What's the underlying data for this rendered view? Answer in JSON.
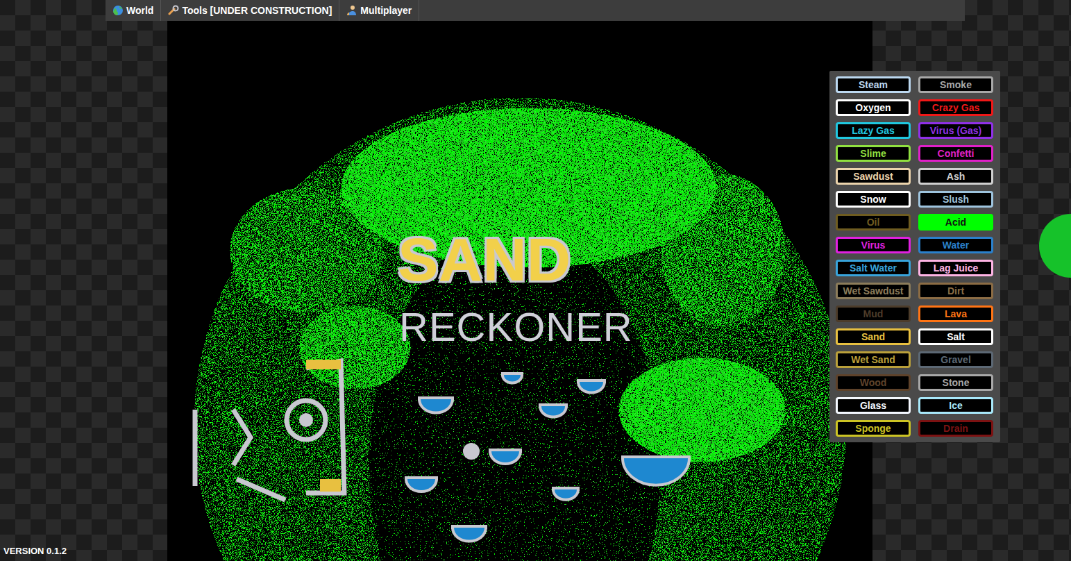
{
  "nav": {
    "items": [
      {
        "label": "World"
      },
      {
        "label": "Tools [UNDER CONSTRUCTION]"
      },
      {
        "label": "Multiplayer"
      }
    ]
  },
  "canvas": {
    "texts": [
      "SAND",
      "RECKONER"
    ]
  },
  "elements": {
    "items": [
      {
        "label": "Steam",
        "color": "#bcd8f0",
        "selected": false
      },
      {
        "label": "Smoke",
        "color": "#a8a8a8",
        "selected": false
      },
      {
        "label": "Oxygen",
        "color": "#ffffff",
        "selected": false
      },
      {
        "label": "Crazy Gas",
        "color": "#f01818",
        "selected": false
      },
      {
        "label": "Lazy Gas",
        "color": "#20c8e0",
        "selected": false
      },
      {
        "label": "Virus (Gas)",
        "color": "#9030e8",
        "selected": false
      },
      {
        "label": "Slime",
        "color": "#90e040",
        "selected": false
      },
      {
        "label": "Confetti",
        "color": "#e020c8",
        "selected": false
      },
      {
        "label": "Sawdust",
        "color": "#ecd4ac",
        "selected": false
      },
      {
        "label": "Ash",
        "color": "#d0d0d0",
        "selected": false
      },
      {
        "label": "Snow",
        "color": "#ffffff",
        "selected": false
      },
      {
        "label": "Slush",
        "color": "#9ec4de",
        "selected": false
      },
      {
        "label": "Oil",
        "color": "#6e5c20",
        "selected": false
      },
      {
        "label": "Acid",
        "color": "#00ff00",
        "selected": true
      },
      {
        "label": "Virus",
        "color": "#e020e0",
        "selected": false
      },
      {
        "label": "Water",
        "color": "#2a80cc",
        "selected": false
      },
      {
        "label": "Salt Water",
        "color": "#38a4dc",
        "selected": false
      },
      {
        "label": "Lag Juice",
        "color": "#ffb4e4",
        "selected": false
      },
      {
        "label": "Wet Sawdust",
        "color": "#8c7c5a",
        "selected": false
      },
      {
        "label": "Dirt",
        "color": "#8c6c44",
        "selected": false
      },
      {
        "label": "Mud",
        "color": "#4c3c2a",
        "selected": false
      },
      {
        "label": "Lava",
        "color": "#ff7414",
        "selected": false
      },
      {
        "label": "Sand",
        "color": "#e8c040",
        "selected": false
      },
      {
        "label": "Salt",
        "color": "#ffffff",
        "selected": false
      },
      {
        "label": "Wet Sand",
        "color": "#baa03a",
        "selected": false
      },
      {
        "label": "Gravel",
        "color": "#5c6874",
        "selected": false
      },
      {
        "label": "Wood",
        "color": "#5e422a",
        "selected": false
      },
      {
        "label": "Stone",
        "color": "#a8a8a8",
        "selected": false
      },
      {
        "label": "Glass",
        "color": "#f4f8ff",
        "selected": false
      },
      {
        "label": "Ice",
        "color": "#a8e8fa",
        "selected": false
      },
      {
        "label": "Sponge",
        "color": "#ccc424",
        "selected": false
      },
      {
        "label": "Drain",
        "color": "#7c1212",
        "selected": false
      }
    ]
  },
  "version": "VERSION 0.1.2"
}
